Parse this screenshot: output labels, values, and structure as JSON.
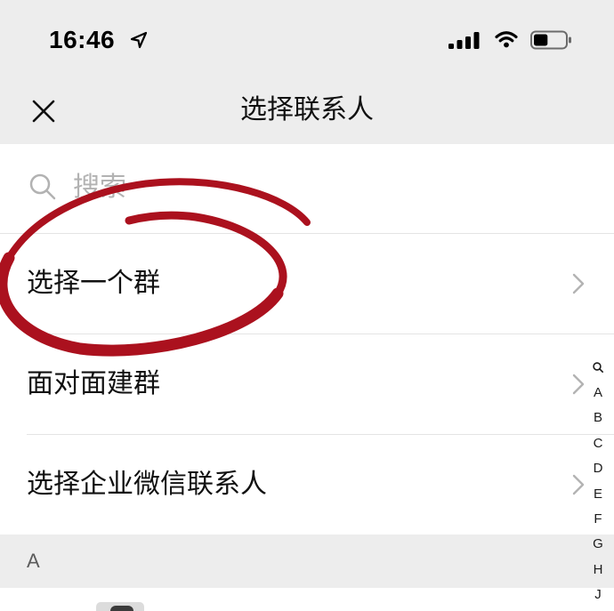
{
  "status_bar": {
    "time": "16:46",
    "battery_level": 0.45,
    "icons": [
      "location-arrow-icon",
      "cellular-signal-icon",
      "wifi-icon",
      "battery-icon"
    ]
  },
  "nav": {
    "title": "选择联系人",
    "close_icon": "close-icon"
  },
  "search": {
    "placeholder": "搜索",
    "icon": "search-icon"
  },
  "menu": {
    "items": [
      {
        "label": "选择一个群",
        "icon": "chevron-right-icon"
      },
      {
        "label": "面对面建群",
        "icon": "chevron-right-icon"
      },
      {
        "label": "选择企业微信联系人",
        "icon": "chevron-right-icon"
      }
    ]
  },
  "contacts": {
    "section_header": "A"
  },
  "index_bar": {
    "search_icon": "search-icon",
    "letters": [
      "A",
      "B",
      "C",
      "D",
      "E",
      "F",
      "G",
      "H",
      "J"
    ]
  },
  "annotation": {
    "color": "#ab111e"
  },
  "colors": {
    "chrome_bg": "#ededed",
    "text": "#111111",
    "placeholder": "#b2b2b2",
    "divider": "#e4e4e4",
    "chevron": "#b3b3b3",
    "section_text": "#5c5c5c"
  }
}
